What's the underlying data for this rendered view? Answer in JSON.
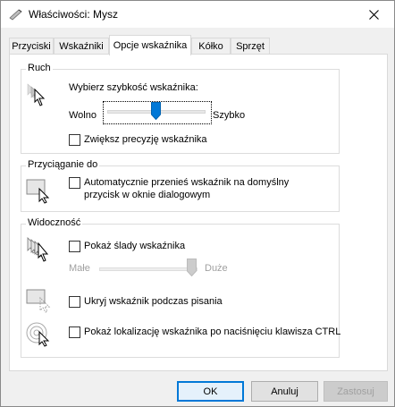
{
  "window": {
    "title": "Właściwości: Mysz"
  },
  "tabs": [
    {
      "label": "Przyciski"
    },
    {
      "label": "Wskaźniki"
    },
    {
      "label": "Opcje wskaźnika",
      "active": true
    },
    {
      "label": "Kółko"
    },
    {
      "label": "Sprzęt"
    }
  ],
  "motion": {
    "legend": "Ruch",
    "speed_label": "Wybierz szybkość wskaźnika:",
    "slow_label": "Wolno",
    "fast_label": "Szybko",
    "speed_value_fraction": 0.5,
    "precision_label": "Zwiększ precyzję wskaźnika",
    "precision_checked": false
  },
  "snap": {
    "legend": "Przyciąganie do",
    "auto_line1": "Automatycznie przenieś wskaźnik na domyślny",
    "auto_line2": "przycisk w oknie dialogowym",
    "auto_checked": false
  },
  "visibility": {
    "legend": "Widoczność",
    "trails_label": "Pokaż ślady wskaźnika",
    "trails_checked": false,
    "short_label": "Małe",
    "long_label": "Duże",
    "trail_value_fraction": 1.0,
    "hide_label": "Ukryj wskaźnik podczas pisania",
    "hide_checked": false,
    "ctrl_label": "Pokaż lokalizację wskaźnika po naciśnięciu klawisza CTRL",
    "ctrl_checked": false
  },
  "buttons": {
    "ok": "OK",
    "cancel": "Anuluj",
    "apply": "Zastosuj"
  },
  "colors": {
    "accent": "#0078d7",
    "disabled_text": "#a0a0a0"
  }
}
